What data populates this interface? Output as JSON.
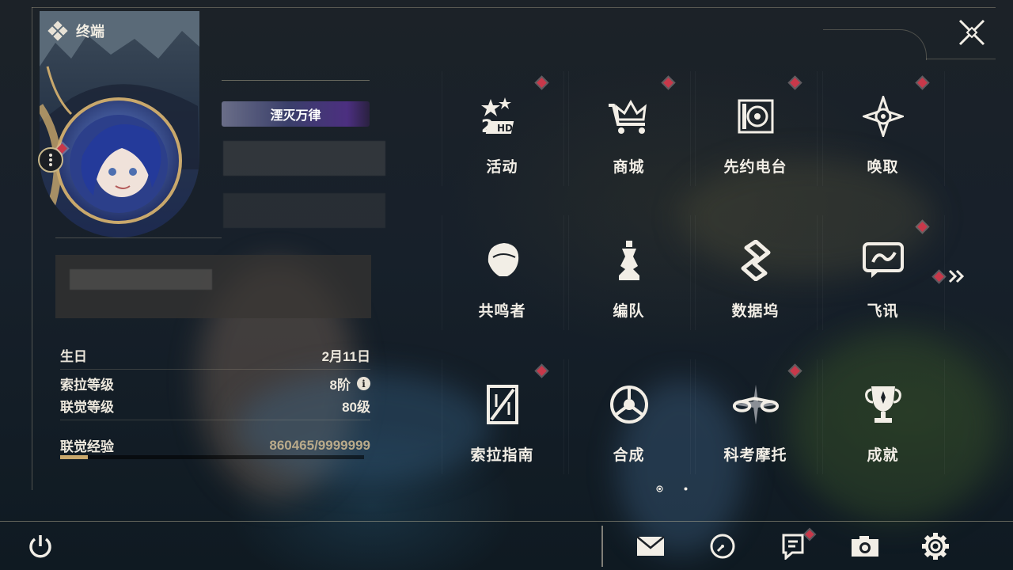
{
  "header": {
    "terminal_label": "终端"
  },
  "profile": {
    "title_badge": "湮灭万律",
    "stats": [
      {
        "label": "生日",
        "value": "2月11日"
      },
      {
        "label": "索拉等级",
        "value": "8阶"
      },
      {
        "label": "联觉等级",
        "value": "80级"
      }
    ],
    "xp": {
      "label": "联觉经验",
      "value": "860465/9999999",
      "current": 860465,
      "max": 9999999
    }
  },
  "menu": {
    "items": [
      {
        "label": "活动",
        "icon": "events-2hd-icon",
        "badge": true
      },
      {
        "label": "商城",
        "icon": "crown-cart-icon",
        "badge": true
      },
      {
        "label": "先约电台",
        "icon": "radio-icon",
        "badge": true
      },
      {
        "label": "唤取",
        "icon": "compass-star-icon",
        "badge": true
      },
      {
        "label": "共鸣者",
        "icon": "resonator-head-icon",
        "badge": false
      },
      {
        "label": "编队",
        "icon": "chess-team-icon",
        "badge": false
      },
      {
        "label": "数据坞",
        "icon": "data-dock-icon",
        "badge": false
      },
      {
        "label": "飞讯",
        "icon": "message-bubble-icon",
        "badge": true
      },
      {
        "label": "索拉指南",
        "icon": "guide-book-icon",
        "badge": true
      },
      {
        "label": "合成",
        "icon": "synthesis-icon",
        "badge": false
      },
      {
        "label": "科考摩托",
        "icon": "motorbike-icon",
        "badge": true
      },
      {
        "label": "成就",
        "icon": "trophy-icon",
        "badge": false
      }
    ],
    "page_count": 2,
    "current_page": 1
  },
  "bottom": {
    "buttons": [
      "power-icon",
      "mail-icon",
      "clock-icon",
      "notice-icon",
      "camera-icon",
      "settings-icon"
    ]
  },
  "colors": {
    "accent": "#c9a86c",
    "badge": "#c8384a",
    "text": "#f2eee6"
  }
}
